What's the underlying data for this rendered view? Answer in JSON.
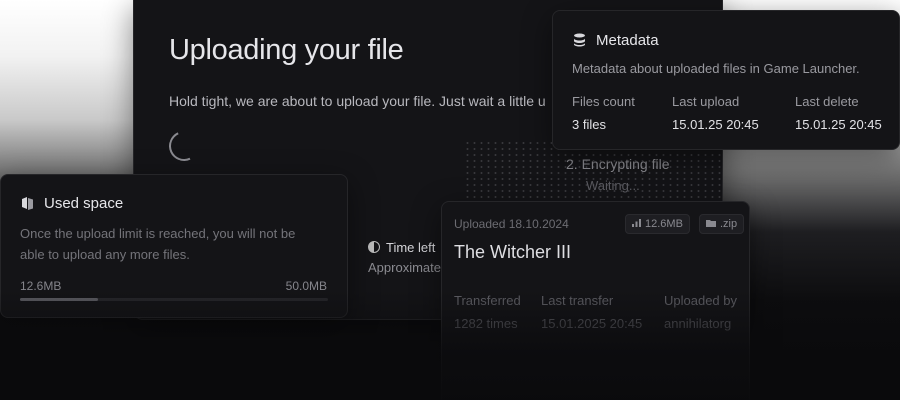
{
  "upload": {
    "title": "Uploading your file",
    "description": "Hold tight, we are about to upload your file. Just wait a little u",
    "step_label": "2. Encrypting file",
    "step_sub": "Waiting...",
    "time_left_label": "Time left",
    "time_left_sub": "Approximate"
  },
  "metadata": {
    "icon": "database-icon",
    "title": "Metadata",
    "subtitle": "Metadata about uploaded files in Game Launcher.",
    "columns": [
      {
        "label": "Files count",
        "value": "3 files"
      },
      {
        "label": "Last upload",
        "value": "15.01.25 20:45"
      },
      {
        "label": "Last delete",
        "value": "15.01.25 20:45"
      }
    ]
  },
  "used_space": {
    "icon": "storage-icon",
    "title": "Used space",
    "subtitle": "Once the upload limit is reached, you will not be able to upload any more files.",
    "used": "12.6MB",
    "limit": "50.0MB",
    "used_fraction": 0.252
  },
  "file": {
    "uploaded_date": "Uploaded 18.10.2024",
    "size_badge": "12.6MB",
    "type_badge": ".zip",
    "name": "The Witcher III",
    "stats": [
      {
        "label": "Transferred",
        "value": "1282 times"
      },
      {
        "label": "Last transfer",
        "value": "15.01.2025 20:45"
      },
      {
        "label": "Uploaded by",
        "value": "annihilatorg"
      }
    ]
  },
  "colors": {
    "background": "#0a0a0c",
    "card": "#141417",
    "border": "#262629"
  }
}
